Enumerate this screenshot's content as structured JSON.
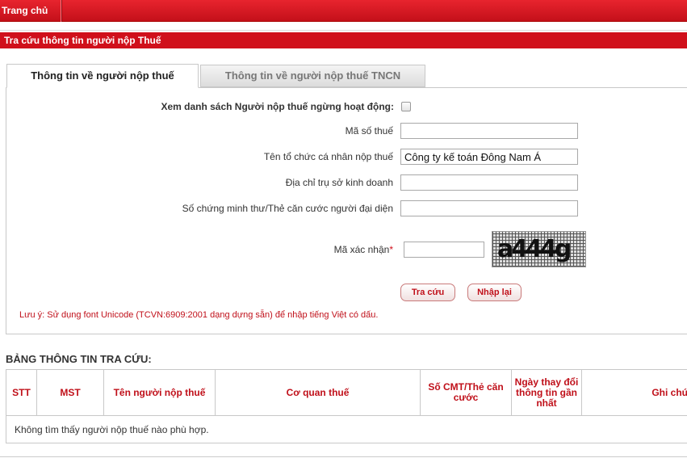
{
  "nav": {
    "home_label": "Trang chủ"
  },
  "section": {
    "title": "Tra cứu thông tin người nộp Thuế"
  },
  "tabs": [
    {
      "label": "Thông tin về người nộp thuế",
      "active": true
    },
    {
      "label": "Thông tin về người nộp thuế TNCN",
      "active": false
    }
  ],
  "form": {
    "inactive_list_label": "Xem danh sách Người nộp thuế ngừng hoạt động:",
    "inactive_list_checked": false,
    "tax_code_label": "Mã số thuế",
    "tax_code_value": "",
    "name_label": "Tên tổ chức cá nhân nộp thuế",
    "name_value": "Công ty kế toán Đông Nam Á",
    "address_label": "Địa chỉ trụ sở kinh doanh",
    "address_value": "",
    "id_label": "Số chứng minh thư/Thẻ căn cước người đại diện",
    "id_value": "",
    "captcha_label": "Mã xác nhận",
    "captcha_required_mark": "*",
    "captcha_value": "",
    "captcha_text": "a444g",
    "search_button": "Tra cứu",
    "reset_button": "Nhập lại",
    "note": "Lưu ý: Sử dụng font Unicode (TCVN:6909:2001 dạng dựng sẵn) để nhập tiếng Việt có dấu."
  },
  "results": {
    "title": "BẢNG THÔNG TIN TRA CỨU:",
    "columns": [
      "STT",
      "MST",
      "Tên người nộp thuế",
      "Cơ quan thuế",
      "Số CMT/Thẻ căn cước",
      "Ngày thay đổi thông tin gần nhất",
      "Ghi chú"
    ],
    "empty_message": "Không tìm thấy người nộp thuế nào phù hợp."
  },
  "colors": {
    "brand_red": "#d0101b",
    "label_red": "#c0101a"
  }
}
